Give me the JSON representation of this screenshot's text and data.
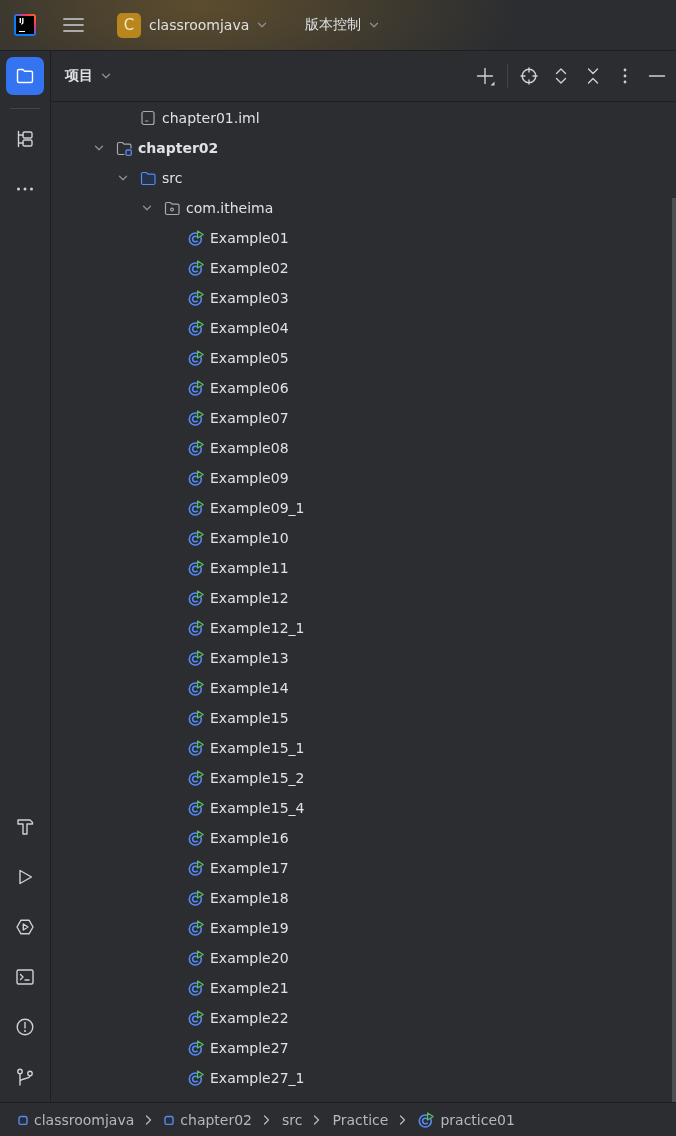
{
  "title_bar": {
    "logo": "IJ",
    "project": {
      "initial": "C",
      "name": "classroomjava"
    },
    "vcs_menu": "版本控制"
  },
  "tool_stripe": {
    "top": [
      {
        "kind": "project",
        "selected": true
      },
      {
        "kind": "structure",
        "selected": false
      },
      {
        "kind": "more",
        "selected": false
      }
    ],
    "bottom": [
      {
        "kind": "build",
        "selected": false
      },
      {
        "kind": "run",
        "selected": false
      },
      {
        "kind": "services",
        "selected": false
      },
      {
        "kind": "terminal",
        "selected": false
      },
      {
        "kind": "problems",
        "selected": false
      },
      {
        "kind": "git",
        "selected": false
      }
    ]
  },
  "project_panel": {
    "title": "项目",
    "toolbar_groups": [
      {
        "items": [
          {
            "kind": "add"
          }
        ]
      },
      {
        "items": [
          {
            "kind": "locate"
          },
          {
            "kind": "expand_all"
          },
          {
            "kind": "collapse_all"
          },
          {
            "kind": "options"
          },
          {
            "kind": "hide"
          }
        ]
      }
    ],
    "tree": [
      {
        "children": [
          {
            "children": [
              {
                "label": "chapter01.iml",
                "kind": "iml"
              }
            ]
          },
          {
            "label": "chapter02",
            "kind": "module",
            "expanded": true,
            "children": [
              {
                "label": "src",
                "kind": "source_folder",
                "expanded": true,
                "children": [
                  {
                    "label": "com.itheima",
                    "kind": "package",
                    "expanded": true,
                    "children": [
                      {
                        "label": "Example01",
                        "kind": "class"
                      },
                      {
                        "label": "Example02",
                        "kind": "class"
                      },
                      {
                        "label": "Example03",
                        "kind": "class"
                      },
                      {
                        "label": "Example04",
                        "kind": "class"
                      },
                      {
                        "label": "Example05",
                        "kind": "class"
                      },
                      {
                        "label": "Example06",
                        "kind": "class"
                      },
                      {
                        "label": "Example07",
                        "kind": "class"
                      },
                      {
                        "label": "Example08",
                        "kind": "class"
                      },
                      {
                        "label": "Example09",
                        "kind": "class"
                      },
                      {
                        "label": "Example09_1",
                        "kind": "class"
                      },
                      {
                        "label": "Example10",
                        "kind": "class"
                      },
                      {
                        "label": "Example11",
                        "kind": "class"
                      },
                      {
                        "label": "Example12",
                        "kind": "class"
                      },
                      {
                        "label": "Example12_1",
                        "kind": "class"
                      },
                      {
                        "label": "Example13",
                        "kind": "class"
                      },
                      {
                        "label": "Example14",
                        "kind": "class"
                      },
                      {
                        "label": "Example15",
                        "kind": "class"
                      },
                      {
                        "label": "Example15_1",
                        "kind": "class"
                      },
                      {
                        "label": "Example15_2",
                        "kind": "class"
                      },
                      {
                        "label": "Example15_4",
                        "kind": "class"
                      },
                      {
                        "label": "Example16",
                        "kind": "class"
                      },
                      {
                        "label": "Example17",
                        "kind": "class"
                      },
                      {
                        "label": "Example18",
                        "kind": "class"
                      },
                      {
                        "label": "Example19",
                        "kind": "class"
                      },
                      {
                        "label": "Example20",
                        "kind": "class"
                      },
                      {
                        "label": "Example21",
                        "kind": "class"
                      },
                      {
                        "label": "Example22",
                        "kind": "class"
                      },
                      {
                        "label": "Example27",
                        "kind": "class"
                      },
                      {
                        "label": "Example27_1",
                        "kind": "class"
                      }
                    ]
                  }
                ]
              }
            ]
          }
        ]
      }
    ]
  },
  "breadcrumbs": [
    {
      "label": "classroomjava",
      "kind": "module"
    },
    {
      "label": "chapter02",
      "kind": "module"
    },
    {
      "label": "src",
      "kind": "plain"
    },
    {
      "label": "Practice",
      "kind": "plain"
    },
    {
      "label": "practice01",
      "kind": "class"
    }
  ]
}
